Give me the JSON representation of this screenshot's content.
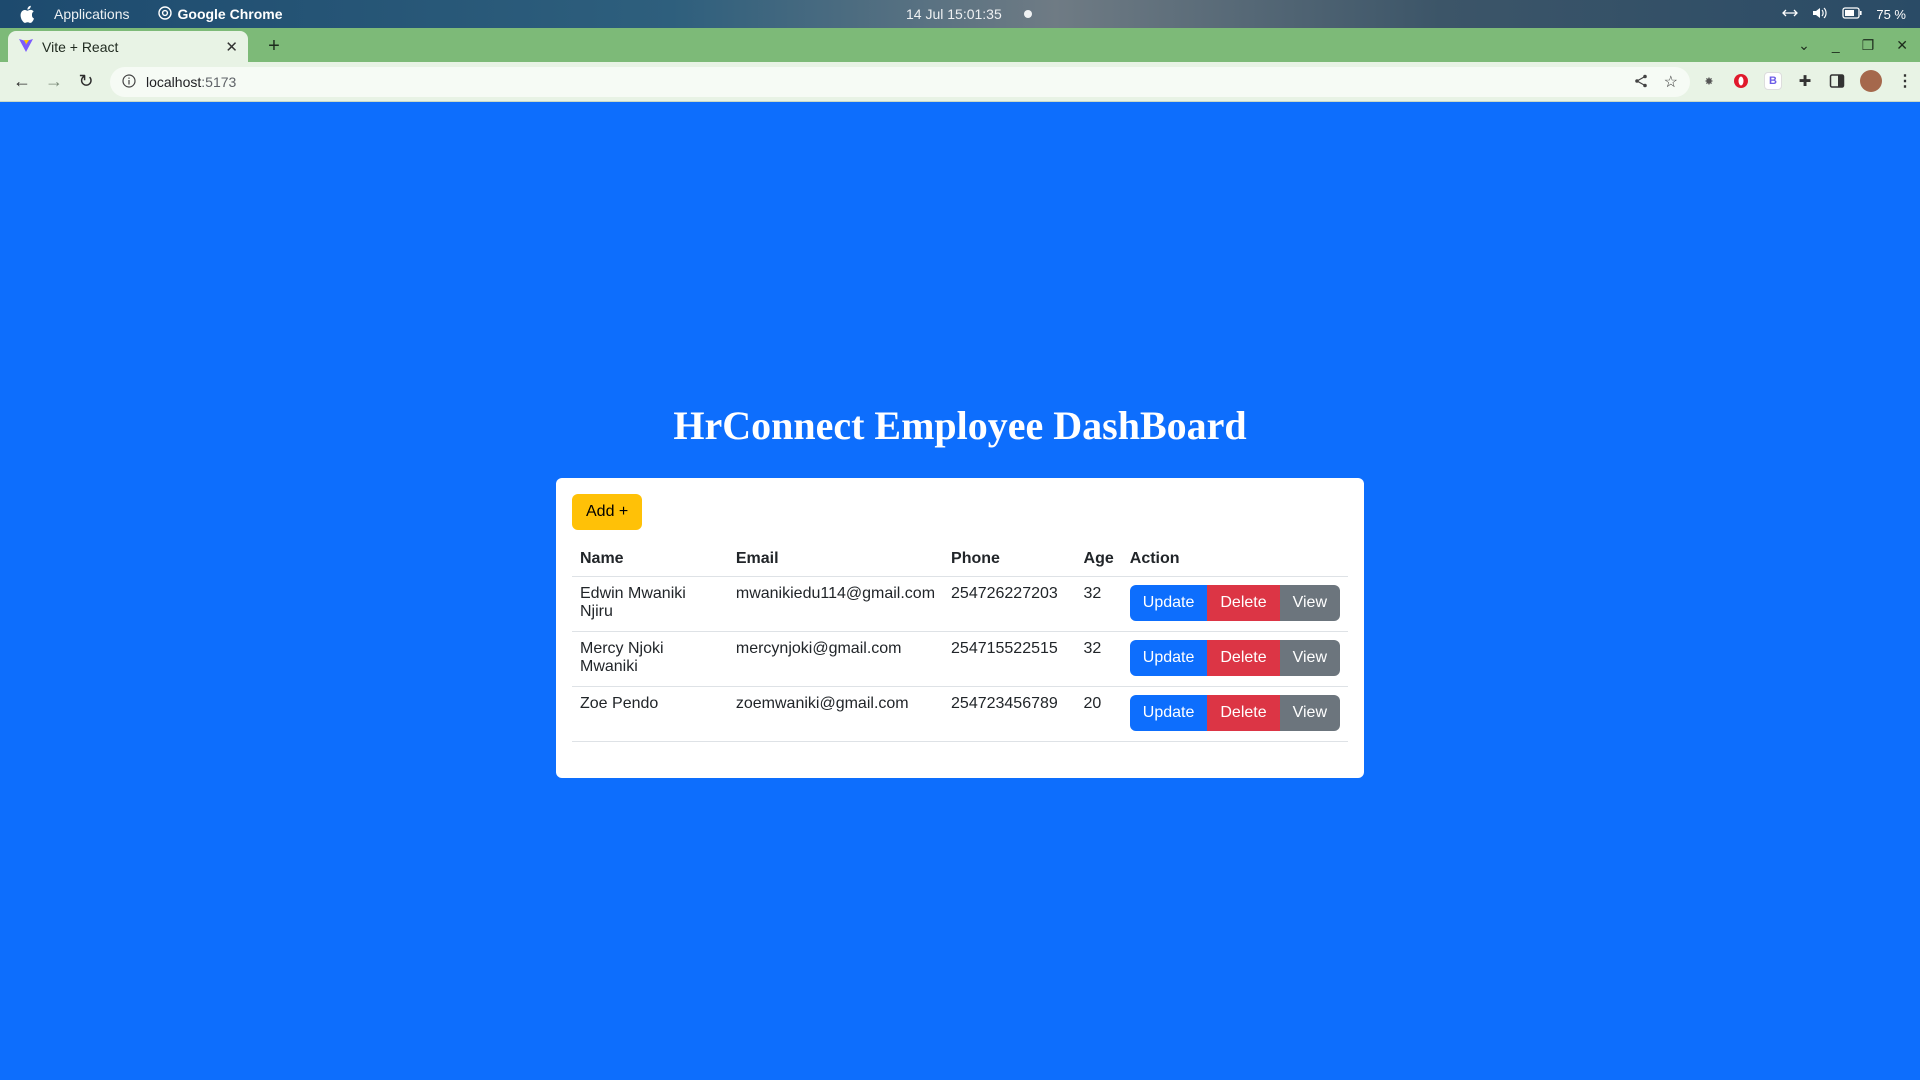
{
  "os_bar": {
    "menu_applications": "Applications",
    "app_name": "Google Chrome",
    "clock": "14 Jul  15:01:35",
    "battery": "75 %"
  },
  "browser": {
    "tab_title": "Vite + React",
    "url_host": "localhost",
    "url_port": ":5173"
  },
  "page": {
    "title": "HrConnect Employee DashBoard",
    "add_button": "Add +",
    "columns": [
      "Name",
      "Email",
      "Phone",
      "Age",
      "Action"
    ],
    "rows": [
      {
        "name": "Edwin Mwaniki Njiru",
        "email": "mwanikiedu114@gmail.com",
        "phone": "254726227203",
        "age": "32"
      },
      {
        "name": "Mercy Njoki Mwaniki",
        "email": "mercynjoki@gmail.com",
        "phone": "254715522515",
        "age": "32"
      },
      {
        "name": "Zoe Pendo",
        "email": "zoemwaniki@gmail.com",
        "phone": "254723456789",
        "age": "20"
      }
    ],
    "actions": {
      "update": "Update",
      "delete": "Delete",
      "view": "View"
    }
  },
  "colors": {
    "page_bg": "#0d6efd",
    "add": "#ffc107",
    "update": "#0d6efd",
    "delete": "#dc3545",
    "view": "#6c757d"
  }
}
